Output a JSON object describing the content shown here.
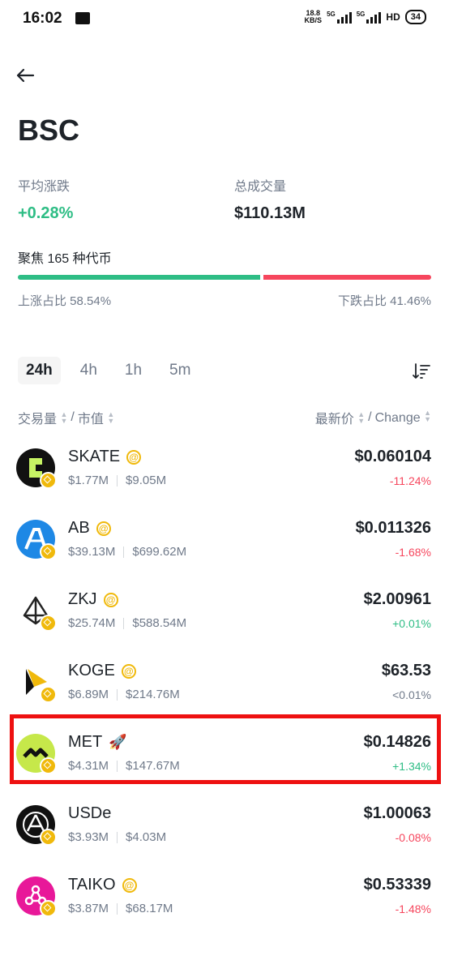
{
  "status_bar": {
    "time": "16:02",
    "speed_top": "18.8",
    "speed_bottom": "KB/S",
    "net1": "5G",
    "net2": "5G",
    "hd": "HD",
    "battery": "34"
  },
  "header": {
    "back_icon": "arrow-left-icon",
    "title": "BSC"
  },
  "stats": {
    "avg_change_label": "平均涨跌",
    "avg_change_value": "+0.28%",
    "volume_label": "总成交量",
    "volume_value": "$110.13M"
  },
  "focus": {
    "text": "聚焦 165 种代币",
    "up_ratio": 58.54,
    "down_ratio": 41.46,
    "up_label": "上涨占比 58.54%",
    "down_label": "下跌占比 41.46%"
  },
  "tabs": [
    {
      "label": "24h",
      "active": true
    },
    {
      "label": "4h",
      "active": false
    },
    {
      "label": "1h",
      "active": false
    },
    {
      "label": "5m",
      "active": false
    }
  ],
  "columns": {
    "volume": "交易量",
    "slash1": "/",
    "mcap": "市值",
    "price": "最新价",
    "slash2": "/",
    "change": "Change"
  },
  "colors": {
    "up": "#2ebd85",
    "down": "#f6465d",
    "accent": "#f0b90b",
    "highlight": "#ee1111"
  },
  "tokens": [
    {
      "name": "SKATE",
      "badge": "at",
      "volume": "$1.77M",
      "mcap": "$9.05M",
      "price": "$0.060104",
      "change": "-11.24%",
      "trend": "down",
      "icon": "skate-logo-icon"
    },
    {
      "name": "AB",
      "badge": "at",
      "volume": "$39.13M",
      "mcap": "$699.62M",
      "price": "$0.011326",
      "change": "-1.68%",
      "trend": "down",
      "icon": "ab-logo-icon"
    },
    {
      "name": "ZKJ",
      "badge": "at",
      "volume": "$25.74M",
      "mcap": "$588.54M",
      "price": "$2.00961",
      "change": "+0.01%",
      "trend": "up",
      "icon": "zkj-logo-icon"
    },
    {
      "name": "KOGE",
      "badge": "at",
      "volume": "$6.89M",
      "mcap": "$214.76M",
      "price": "$63.53",
      "change": "<0.01%",
      "trend": "flat",
      "icon": "koge-logo-icon"
    },
    {
      "name": "MET",
      "badge": "rocket",
      "volume": "$4.31M",
      "mcap": "$147.67M",
      "price": "$0.14826",
      "change": "+1.34%",
      "trend": "up",
      "icon": "met-logo-icon",
      "highlighted": true
    },
    {
      "name": "USDe",
      "badge": "none",
      "volume": "$3.93M",
      "mcap": "$4.03M",
      "price": "$1.00063",
      "change": "-0.08%",
      "trend": "down",
      "icon": "usde-logo-icon"
    },
    {
      "name": "TAIKO",
      "badge": "at",
      "volume": "$3.87M",
      "mcap": "$68.17M",
      "price": "$0.53339",
      "change": "-1.48%",
      "trend": "down",
      "icon": "taiko-logo-icon"
    }
  ]
}
